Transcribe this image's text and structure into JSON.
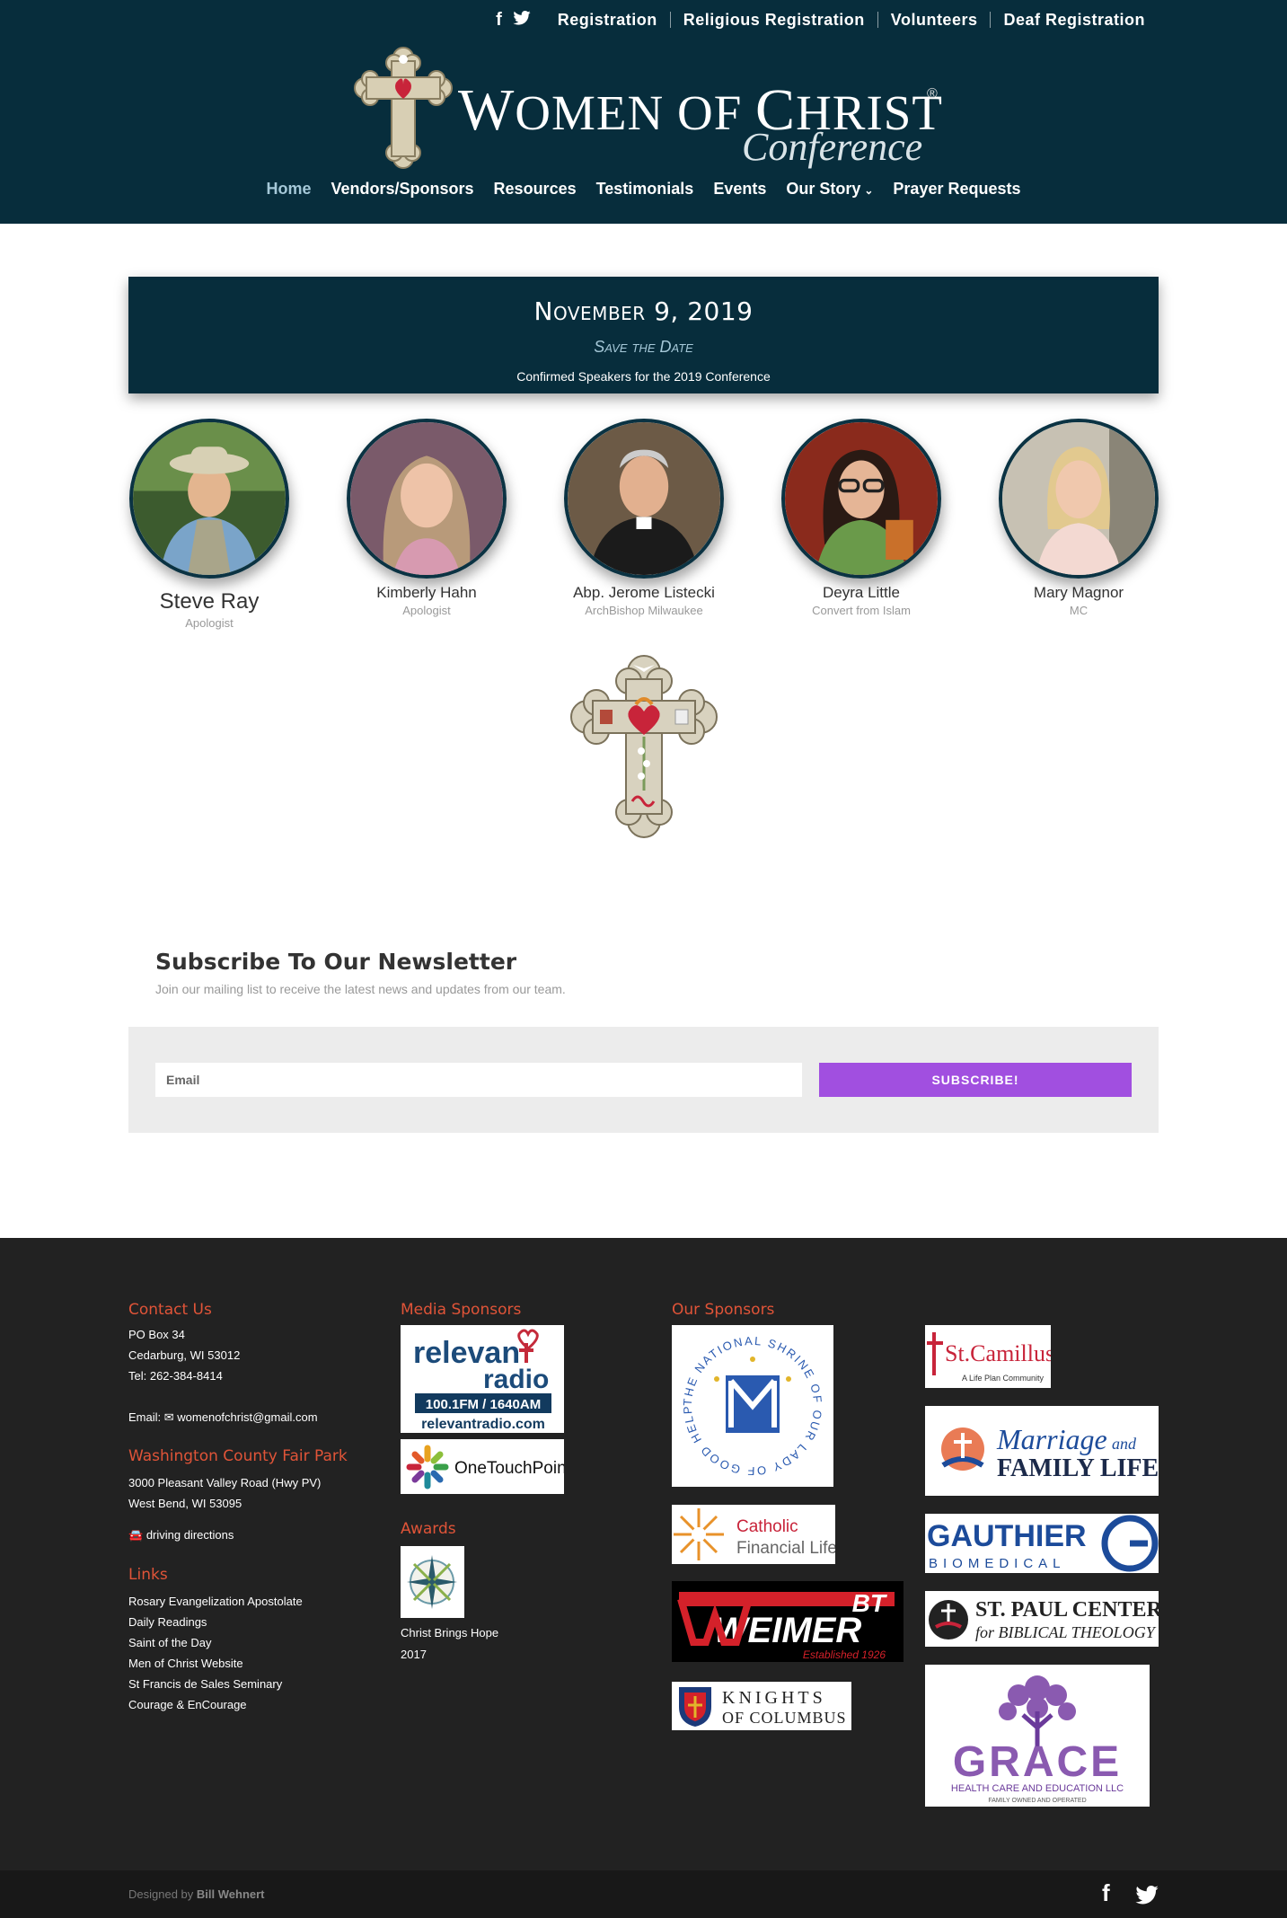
{
  "header": {
    "top_links": [
      "Registration",
      "Religious Registration",
      "Volunteers",
      "Deaf Registration"
    ],
    "social": [
      "facebook-icon",
      "twitter-icon"
    ],
    "logo_title_first": "W",
    "logo_title_rest_1": "OMEN OF ",
    "logo_title_c": "C",
    "logo_title_rest_2": "HRIST",
    "logo_reg": "®",
    "logo_subtitle": "Conference",
    "nav": [
      {
        "label": "Home",
        "active": true
      },
      {
        "label": "Vendors/Sponsors"
      },
      {
        "label": "Resources"
      },
      {
        "label": "Testimonials"
      },
      {
        "label": "Events"
      },
      {
        "label": "Our Story",
        "dropdown": true
      },
      {
        "label": "Prayer Requests"
      }
    ],
    "brand_color": "#072d3c",
    "active_color": "#a5c8d8"
  },
  "banner": {
    "date": "November 9, 2019",
    "subtitle": "Save the Date",
    "description": "Confirmed Speakers for the 2019 Conference"
  },
  "speakers": [
    {
      "name": "Steve Ray",
      "role": "Apologist"
    },
    {
      "name": "Kimberly Hahn",
      "role": "Apologist"
    },
    {
      "name": "Abp. Jerome Listecki",
      "role": "ArchBishop Milwaukee"
    },
    {
      "name": "Deyra Little",
      "role": "Convert from Islam"
    },
    {
      "name": "Mary Magnor",
      "role": "MC"
    }
  ],
  "newsletter": {
    "title": "Subscribe To Our Newsletter",
    "description": "Join our mailing list to receive the latest news and updates from our team.",
    "email_placeholder": "Email",
    "button_label": "SUBSCRIBE!",
    "button_color": "#a14fe0"
  },
  "footer": {
    "contact_heading": "Contact Us",
    "contact_lines": [
      "PO Box 34",
      "Cedarburg, WI 53012",
      "Tel: 262-384-8414"
    ],
    "email_label": "Email:",
    "email": "womenofchrist@gmail.com",
    "venue_heading": "Washington County Fair Park",
    "venue_lines": [
      "3000 Pleasant Valley Road (Hwy PV)",
      "West Bend, WI 53095"
    ],
    "directions": "driving directions",
    "links_heading": "Links",
    "links": [
      "Rosary Evangelization Apostolate",
      "Daily Readings",
      "Saint of the Day",
      "Men of Christ Website",
      "St Francis de Sales Seminary",
      "Courage & EnCourage"
    ],
    "media_heading": "Media Sponsors",
    "media_sponsors": {
      "relevant_1": "relevan",
      "relevant_2": "radio",
      "relevant_freq": "100.1FM / 1640AM",
      "relevant_url": "relevantradio.com",
      "onetouch": "OneTouchPoint"
    },
    "awards_heading": "Awards",
    "award_lines": [
      "Christ Brings Hope",
      "2017"
    ],
    "sponsors_heading": "Our Sponsors",
    "sponsors": {
      "shrine_ring": "THE NATIONAL SHRINE OF OUR LADY OF GOOD HELP",
      "catholic_1": "Catholic",
      "catholic_2": "Financial Life",
      "weimer": "WEIMER",
      "weimer_bt": "BT",
      "weimer_est": "Established 1926",
      "knights_1": "KNIGHTS",
      "knights_2": "OF COLUMBUS",
      "camillus": "St.Camillus",
      "camillus_sub": "A Life Plan Community",
      "marriage_1": "Marriage",
      "marriage_and": "and",
      "marriage_2": "FAMILY LIFE",
      "gauthier_1": "GAUTHIER",
      "gauthier_2": "BIOMEDICAL",
      "stpaul_1": "ST. PAUL CENTER",
      "stpaul_2": "for BIBLICAL THEOLOGY",
      "grace_1": "GRACE",
      "grace_2": "HEALTH CARE AND EDUCATION LLC",
      "grace_3": "FAMILY OWNED AND OPERATED"
    },
    "accent_color": "#e05438"
  },
  "bottom": {
    "credit_prefix": "Designed by",
    "credit_name": "Bill Wehnert"
  }
}
